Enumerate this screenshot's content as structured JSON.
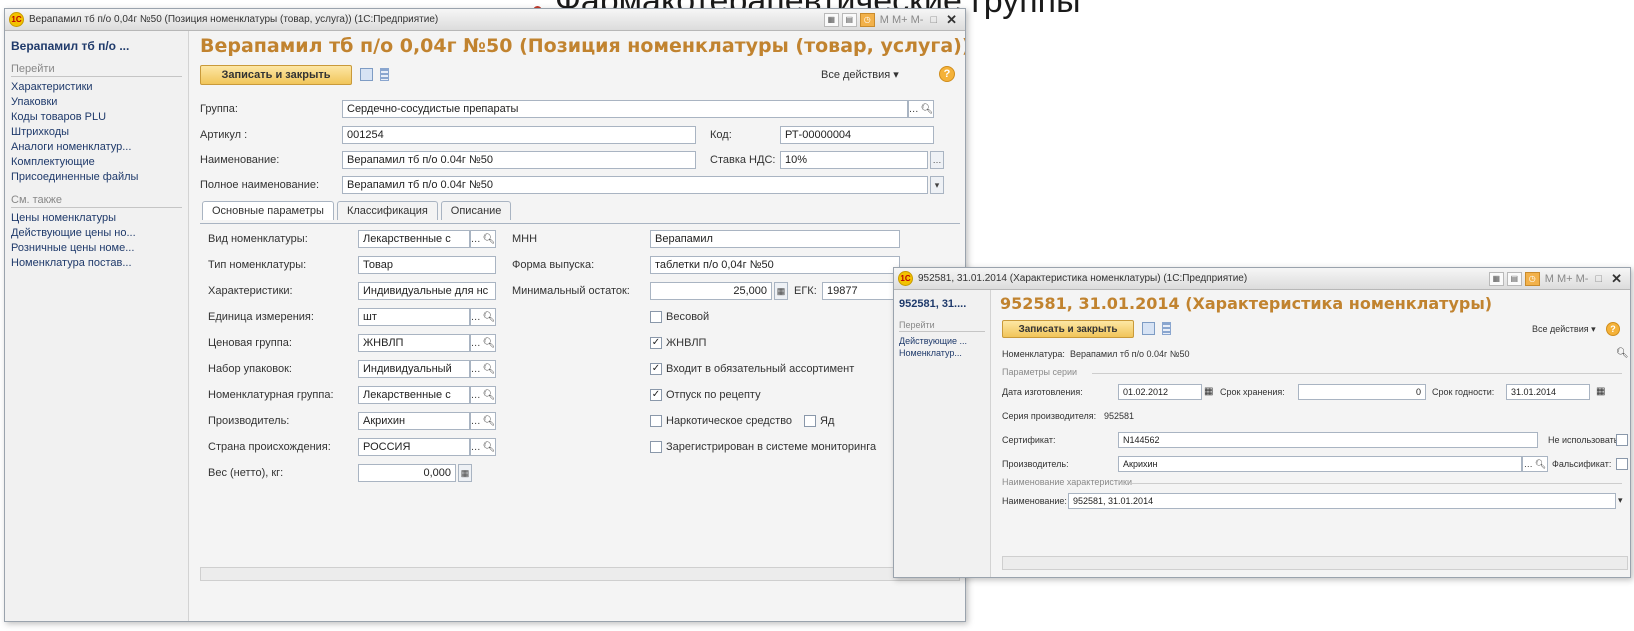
{
  "slide": {
    "title": "Фармакотерапевтические группы"
  },
  "w1": {
    "titlebar": "Верапамил тб п/о 0,04г №50 (Позиция номенклатуры (товар, услуга)) (1С:Предприятие)",
    "sidebar": {
      "heading": "Верапамил тб п/о ...",
      "section_go": "Перейти",
      "go_items": [
        "Характеристики",
        "Упаковки",
        "Коды товаров PLU",
        "Штрихкоды",
        "Аналоги номенклатур...",
        "Комплектующие",
        "Присоединенные файлы"
      ],
      "section_related": "См. также",
      "related_items": [
        "Цены номенклатуры",
        "Действующие цены но...",
        "Розничные цены номе...",
        "Номенклатура постав..."
      ]
    },
    "form_title": "Верапамил тб п/о 0,04г №50 (Позиция номенклатуры (товар, услуга))",
    "save_close": "Записать и закрыть",
    "all_actions": "Все действия ▾",
    "group_label": "Группа:",
    "group_value": "Сердечно-сосудистые препараты",
    "article_label": "Артикул :",
    "article_value": "001254",
    "code_label": "Код:",
    "code_value": "РТ-00000004",
    "name_label": "Наименование:",
    "name_value": "Верапамил тб п/о 0.04г №50",
    "vat_label": "Ставка НДС:",
    "vat_value": "10%",
    "fullname_label": "Полное наименование:",
    "fullname_value": "Верапамил тб п/о 0.04г №50",
    "tabs": [
      "Основные параметры",
      "Классификация",
      "Описание"
    ],
    "left_fields": [
      {
        "label": "Вид номенклатуры:",
        "value": "Лекарственные с"
      },
      {
        "label": "Тип номенклатуры:",
        "value": "Товар"
      },
      {
        "label": "Характеристики:",
        "value": "Индивидуальные для нс"
      },
      {
        "label": "Единица измерения:",
        "value": "шт"
      },
      {
        "label": "Ценовая группа:",
        "value": "ЖНВЛП"
      },
      {
        "label": "Набор упаковок:",
        "value": "Индивидуальный"
      },
      {
        "label": "Номенклатурная группа:",
        "value": "Лекарственные с"
      },
      {
        "label": "Производитель:",
        "value": "Акрихин"
      },
      {
        "label": "Страна происхождения:",
        "value": "РОССИЯ"
      }
    ],
    "weight_label": "Вес (нетто), кг:",
    "weight_value": "0,000",
    "mnn_label": "МНН",
    "mnn_value": "Верапамил",
    "form_label": "Форма выпуска:",
    "form_value": "таблетки п/о 0,04г №50",
    "min_label": "Минимальный остаток:",
    "min_value": "25,000",
    "egk_label": "ЕГК:",
    "egk_value": "19877",
    "checks": [
      {
        "label": "Весовой",
        "checked": false
      },
      {
        "label": "ЖНВЛП",
        "checked": true
      },
      {
        "label": "Входит в обязательный ассортимент",
        "checked": true
      },
      {
        "label": "Отпуск по рецепту",
        "checked": true
      },
      {
        "label": "Наркотическое средство",
        "checked": false
      },
      {
        "label": "Зарегистрирован в системе мониторинга",
        "checked": false
      }
    ],
    "poison_label": "Яд"
  },
  "w2": {
    "titlebar": "952581, 31.01.2014 (Характеристика номенклатуры) (1С:Предприятие)",
    "sidebar": {
      "heading": "952581, 31....",
      "section_go": "Перейти",
      "items": [
        "Действующие ...",
        "Номенклатур..."
      ]
    },
    "form_title": "952581, 31.01.2014 (Характеристика номенклатуры)",
    "save_close": "Записать и закрыть",
    "all_actions": "Все действия ▾",
    "nom_label": "Номенклатура:",
    "nom_value": "Верапамил тб п/о 0.04г №50",
    "series_group": "Параметры серии",
    "mfg_label": "Дата изготовления:",
    "mfg_value": "01.02.2012",
    "storage_label": "Срок хранения:",
    "storage_value": "0",
    "expiry_label": "Срок годности:",
    "expiry_value": "31.01.2014",
    "series_label": "Серия производителя:",
    "series_value": "952581",
    "cert_label": "Сертификат:",
    "cert_value": "N144562",
    "notuse_label": "Не использовать:",
    "maker_label": "Производитель:",
    "maker_value": "Акрихин",
    "fake_label": "Фальсификат:",
    "name_group": "Наименование характеристики",
    "name_label": "Наименование:",
    "name_value": "952581, 31.01.2014"
  }
}
